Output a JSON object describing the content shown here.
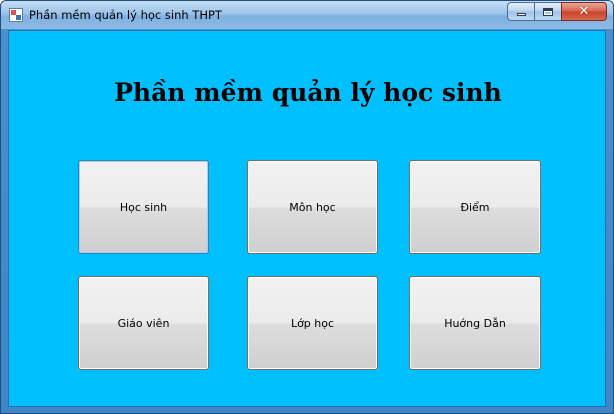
{
  "window": {
    "title": "Phần mềm quản lý học sinh THPT",
    "icons": {
      "app": "app-icon",
      "minimize": "minimize-icon",
      "maximize": "maximize-icon",
      "close": "close-icon"
    },
    "close_glyph": "✕"
  },
  "main": {
    "heading": "Phần mềm quản lý học sinh",
    "background_color": "#00bfff",
    "buttons": [
      {
        "label": "Học sinh"
      },
      {
        "label": "Môn học"
      },
      {
        "label": "Điểm"
      },
      {
        "label": "Giáo viên"
      },
      {
        "label": "Lớp học"
      },
      {
        "label": "Huớng Dẫn"
      }
    ]
  }
}
